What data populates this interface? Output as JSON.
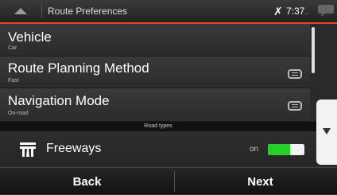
{
  "header": {
    "title": "Route Preferences",
    "gps_icon": "satellite-icon",
    "time": "7:37",
    "time_suffix": "..",
    "message_icon": "speech-bubble-icon",
    "accent_color": "#e04a2a"
  },
  "list": [
    {
      "label": "Vehicle",
      "value": "Car",
      "icon": null
    },
    {
      "label": "Route Planning Method",
      "value": "Fast",
      "icon": "list-icon"
    },
    {
      "label": "Navigation Mode",
      "value": "On-road",
      "icon": "list-icon"
    }
  ],
  "section": {
    "title": "Road types"
  },
  "freeways": {
    "label": "Freeways",
    "state": "on",
    "icon": "freeway-icon",
    "toggle_color": "#25d027"
  },
  "footer": {
    "back": "Back",
    "next": "Next"
  }
}
